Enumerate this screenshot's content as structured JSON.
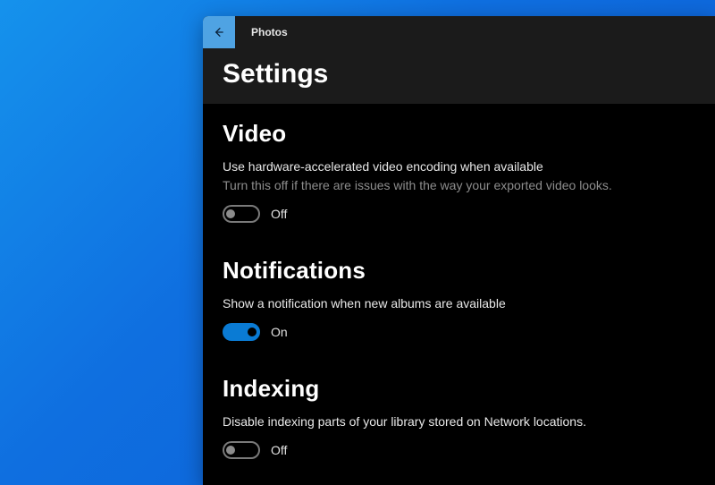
{
  "app": {
    "title": "Photos"
  },
  "page": {
    "title": "Settings"
  },
  "sections": {
    "video": {
      "title": "Video",
      "label": "Use hardware-accelerated video encoding when available",
      "sublabel": "Turn this off if there are issues with the way your exported video looks.",
      "toggle_state": "Off",
      "toggle_on": false
    },
    "notifications": {
      "title": "Notifications",
      "label": "Show a notification when new albums are available",
      "toggle_state": "On",
      "toggle_on": true
    },
    "indexing": {
      "title": "Indexing",
      "label": "Disable indexing parts of your library stored on Network locations.",
      "toggle_state": "Off",
      "toggle_on": false
    }
  }
}
